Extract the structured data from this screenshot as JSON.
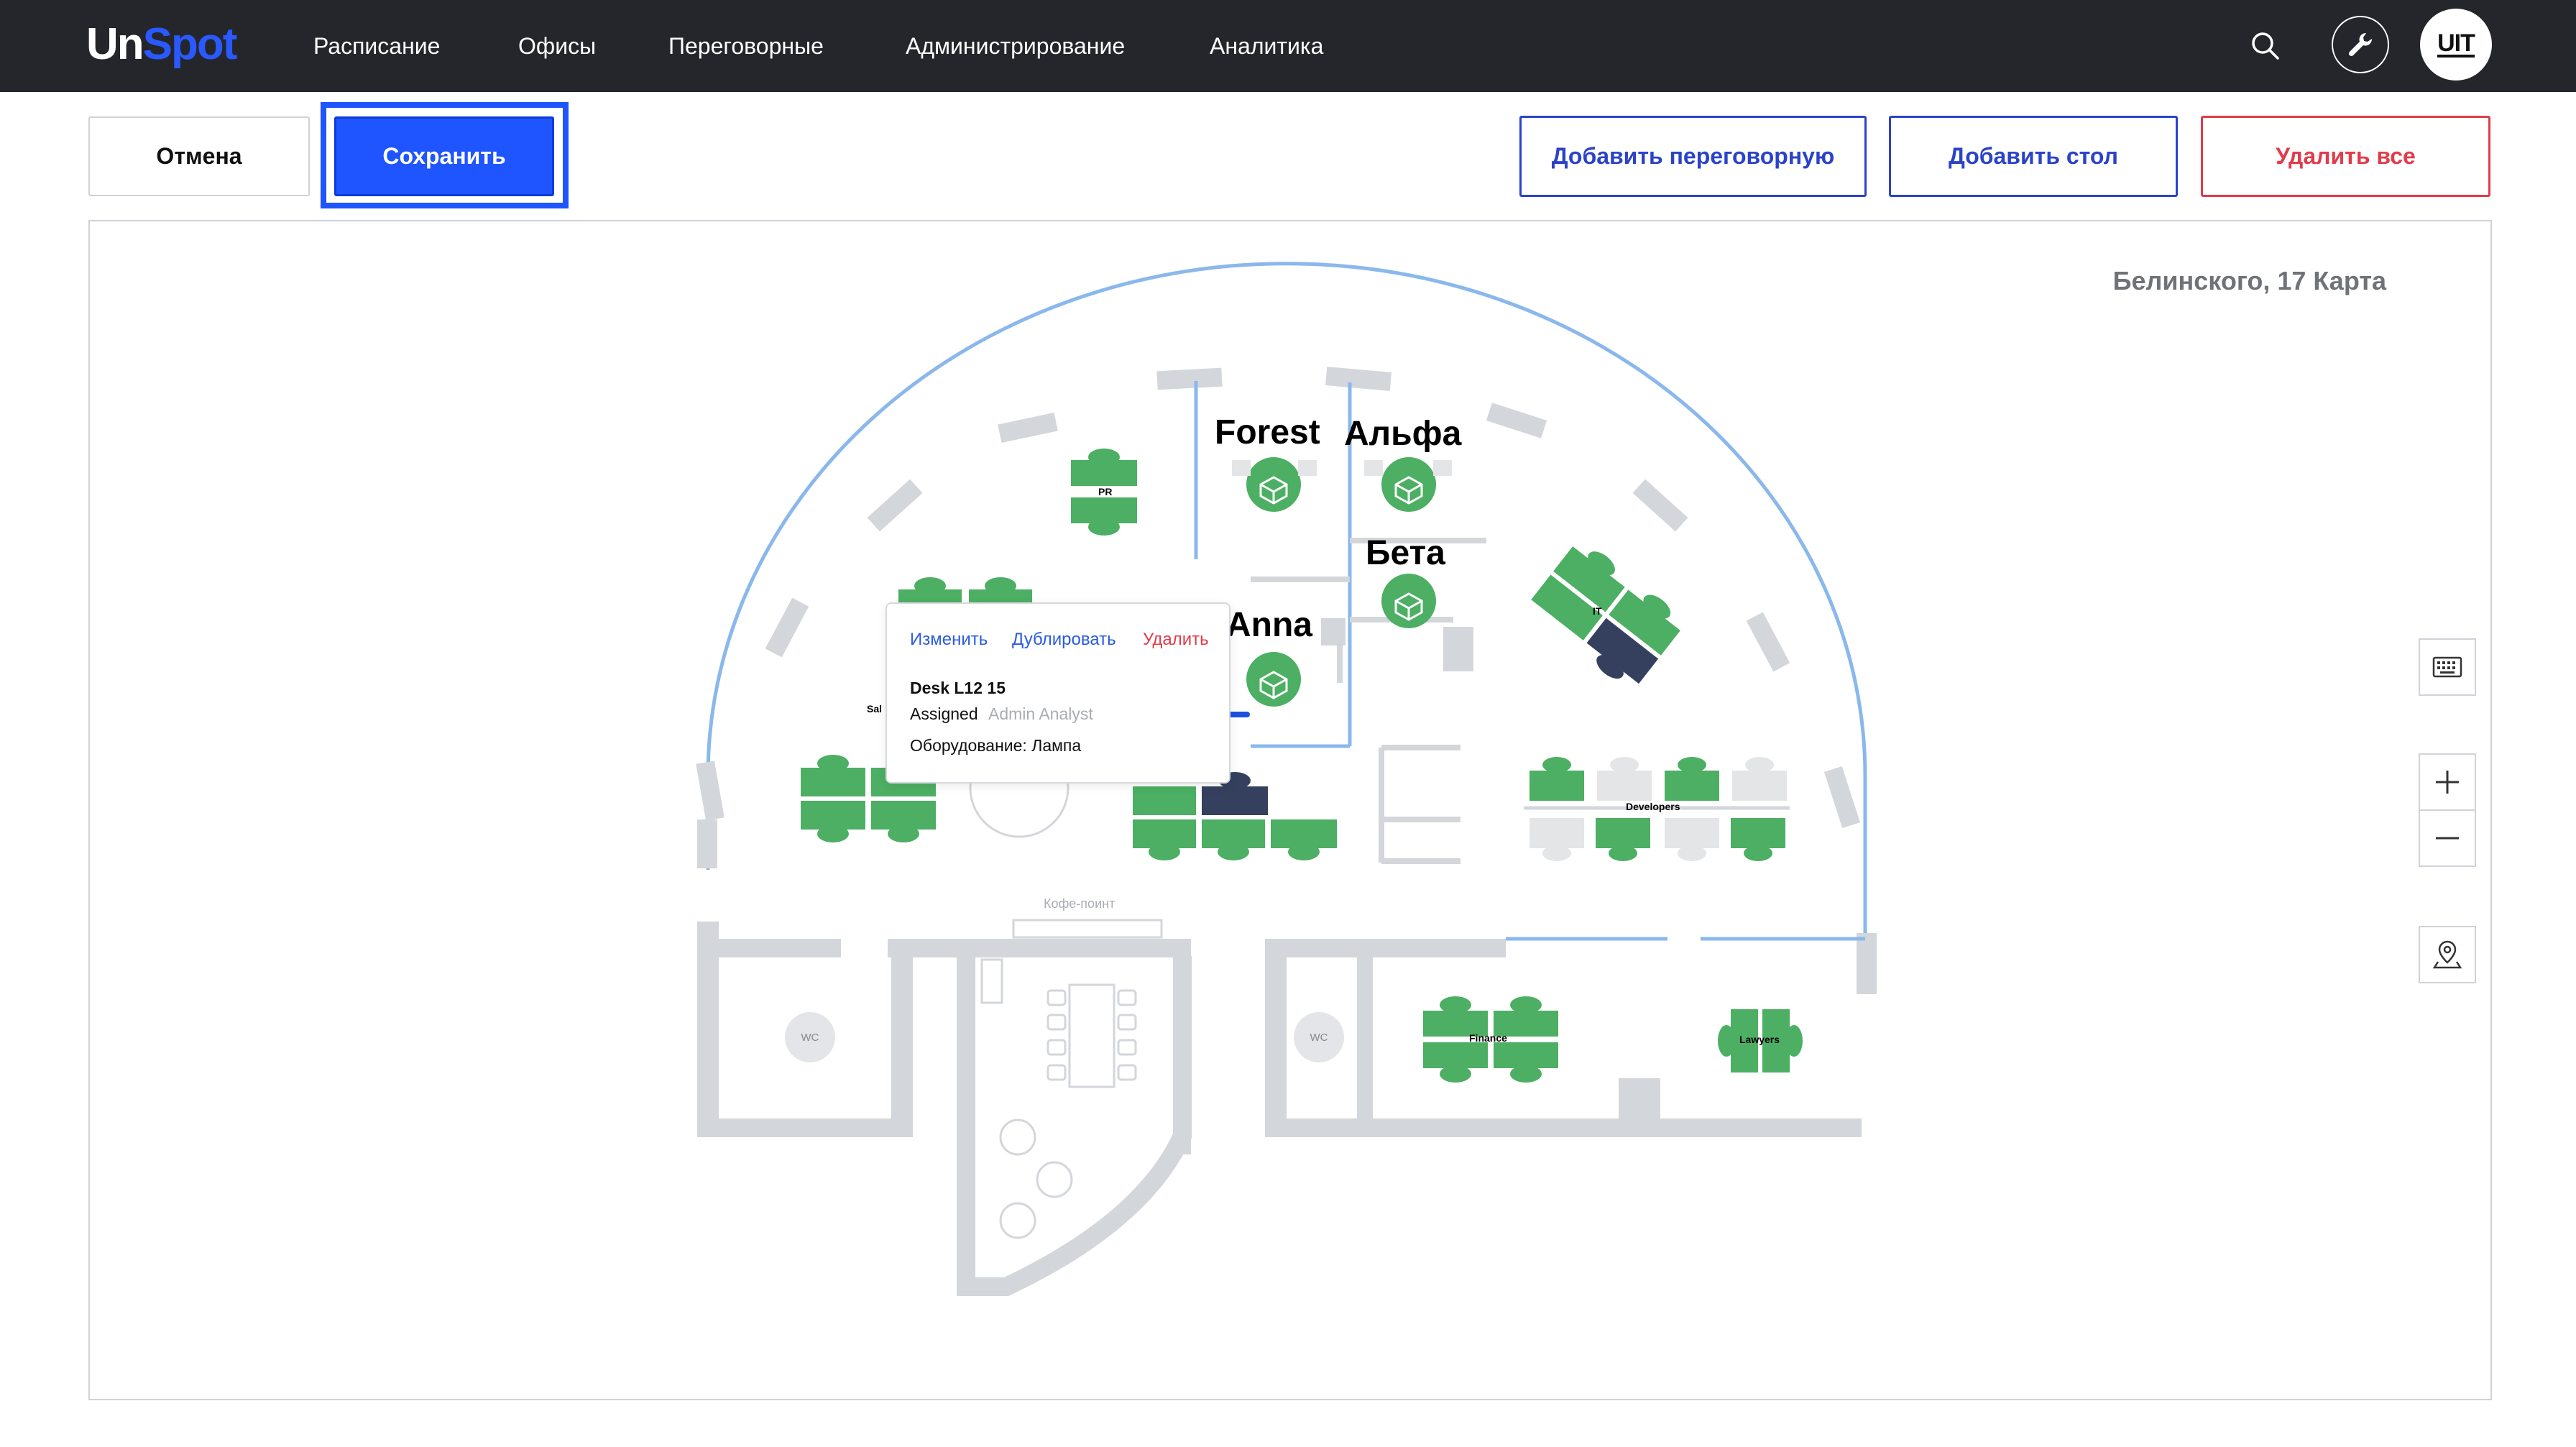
{
  "app": {
    "logo_un": "Un",
    "logo_spot": "Spot"
  },
  "nav": {
    "items": [
      "Расписание",
      "Офисы",
      "Переговорные",
      "Администрирование",
      "Аналитика"
    ]
  },
  "header": {
    "avatar_text": "UIT"
  },
  "toolbar": {
    "cancel_label": "Отмена",
    "save_label": "Сохранить",
    "add_room_label": "Добавить переговорную",
    "add_desk_label": "Добавить стол",
    "delete_all_label": "Удалить все"
  },
  "map": {
    "title": "Белинского, 17 Карта",
    "rooms": [
      "Forest",
      "Альфа",
      "Бета",
      "Anna"
    ],
    "zones": [
      "PR",
      "IT",
      "Developers",
      "Finance",
      "Lawyers",
      "Sal"
    ],
    "coffee_point": "Кофе-поинт",
    "wc_label": "WC"
  },
  "popover": {
    "edit_label": "Изменить",
    "duplicate_label": "Дублировать",
    "delete_label": "Удалить",
    "desk_name": "Desk L12 15",
    "assigned_label": "Assigned",
    "assigned_value": "Admin Analyst",
    "equipment_label": "Оборудование:",
    "equipment_value": "Лампа"
  },
  "colors": {
    "topbar": "#24262c",
    "accent": "#1f55ff",
    "outline_blue": "#2b43c9",
    "danger": "#e23b4a",
    "desk_free": "#4caf63",
    "desk_occupied": "#34405e",
    "desk_disabled": "#e4e5e7",
    "wall": "#d3d6da",
    "glass": "#8ab8ec"
  }
}
